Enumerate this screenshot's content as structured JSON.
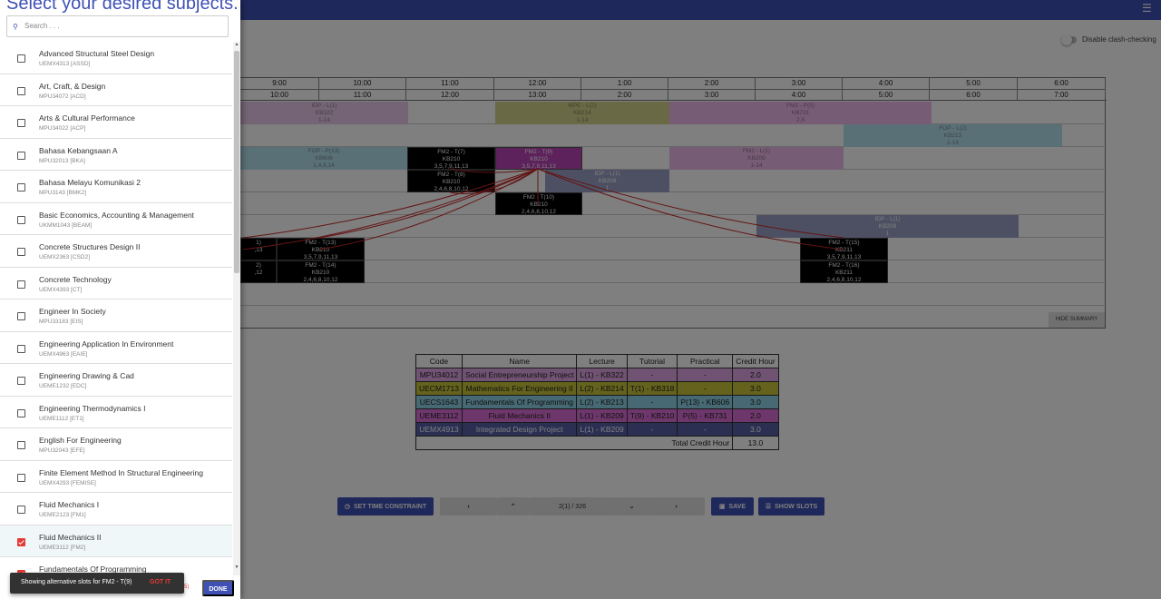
{
  "header": {
    "menu_icon": "hamburger-menu-icon"
  },
  "clash": {
    "label": "Disable clash-checking"
  },
  "timetable": {
    "columns": [
      {
        "start": "9:00",
        "end": "10:00"
      },
      {
        "start": "10:00",
        "end": "11:00"
      },
      {
        "start": "11:00",
        "end": "12:00"
      },
      {
        "start": "12:00",
        "end": "13:00"
      },
      {
        "start": "1:00",
        "end": "2:00"
      },
      {
        "start": "2:00",
        "end": "3:00"
      },
      {
        "start": "3:00",
        "end": "4:00"
      },
      {
        "start": "4:00",
        "end": "5:00"
      },
      {
        "start": "5:00",
        "end": "6:00"
      },
      {
        "start": "6:00",
        "end": "7:00"
      }
    ],
    "slots": [
      {
        "l1": "IDP - L(1)",
        "l2": "KB322",
        "l3": "1-14",
        "color": "#e9c8eb"
      },
      {
        "l1": "MPE - L(2)",
        "l2": "KB214",
        "l3": "1-14",
        "color": "#d5d38a"
      },
      {
        "l1": "FM2 - P(5)",
        "l2": "KB731",
        "l3": "2,8",
        "color": "#eeb8ea"
      },
      {
        "l1": "FOP - L(2)",
        "l2": "KB213",
        "l3": "1-14",
        "color": "#b4e0ee"
      },
      {
        "l1": "FOP - P(13)",
        "l2": "KB606",
        "l3": "1,4,8,14",
        "color": "#b4e0ee"
      },
      {
        "l1": "FM2 - T(7)",
        "l2": "KB210",
        "l3": "3,5,7,9,11,13",
        "color": "#000000"
      },
      {
        "l1": "FM2 - T(9)",
        "l2": "KB210",
        "l3": "3,5,7,9,11,13",
        "color": "#bb44b9"
      },
      {
        "l1": "FM2 - L(1)",
        "l2": "KB209",
        "l3": "1-14",
        "color": "#eeb8ea"
      },
      {
        "l1": "FM2 - T(8)",
        "l2": "KB210",
        "l3": "2,4,6,8,10,12",
        "color": "#000000"
      },
      {
        "l1": "IDP - L(1)",
        "l2": "KB209",
        "l3": "1",
        "color": "#9aa0c4"
      },
      {
        "l1": "FM2 - T(10)",
        "l2": "KB210",
        "l3": "2,4,6,8,10,12",
        "color": "#000000"
      },
      {
        "l1": "IDP - L(1)",
        "l2": "KB208",
        "l3": "1",
        "color": "#9aa0c4"
      },
      {
        "l1": "1)",
        "l2": "",
        "l3": ",13",
        "color": "#000000"
      },
      {
        "l1": "FM2 - T(13)",
        "l2": "KB210",
        "l3": "3,5,7,9,11,13",
        "color": "#000000"
      },
      {
        "l1": "FM2 - T(15)",
        "l2": "KB211",
        "l3": "3,5,7,9,11,13",
        "color": "#000000"
      },
      {
        "l1": "2)",
        "l2": "",
        "l3": ",12",
        "color": "#000000"
      },
      {
        "l1": "FM2 - T(14)",
        "l2": "KB210",
        "l3": "2,4,6,8,10,12",
        "color": "#000000"
      },
      {
        "l1": "FM2 - T(16)",
        "l2": "KB211",
        "l3": "2,4,6,8,10,12",
        "color": "#000000"
      }
    ],
    "hide_summary": "HIDE SUMMARY"
  },
  "summary": {
    "headers": [
      "Code",
      "Name",
      "Lecture",
      "Tutorial",
      "Practical",
      "Credit Hour"
    ],
    "rows": [
      {
        "code": "MPU34012",
        "name": "Social Entrepreneurship Project",
        "lecture": "L(1) - KB322",
        "tutorial": "-",
        "practical": "-",
        "credit": "2.0",
        "color": "#e1a6e4"
      },
      {
        "code": "UECM1713",
        "name": "Mathematics For Engineering II",
        "lecture": "L(2) - KB214",
        "tutorial": "T(1) - KB318",
        "practical": "-",
        "credit": "3.0",
        "color": "#c9c539"
      },
      {
        "code": "UECS1643",
        "name": "Fundamentals Of Programming",
        "lecture": "L(2) - KB213",
        "tutorial": "-",
        "practical": "P(13) - KB606",
        "credit": "3.0",
        "color": "#8fd2e6"
      },
      {
        "code": "UEME3112",
        "name": "Fluid Mechanics II",
        "lecture": "L(1) - KB209",
        "tutorial": "T(9) - KB210",
        "practical": "P(5) - KB731",
        "credit": "2.0",
        "color": "#dd6fd9"
      },
      {
        "code": "UEMX4913",
        "name": "Integrated Design Project",
        "lecture": "L(1) - KB209",
        "tutorial": "-",
        "practical": "-",
        "credit": "3.0",
        "color": "#5660a6"
      }
    ],
    "total_label": "Total Credit Hour",
    "total_value": "13.0"
  },
  "controls": {
    "set_time_constraint": "SET TIME CONSTRAINT",
    "prev_icon": "chevron-left-icon",
    "up_icon": "chevron-up-icon",
    "page": "2(1) / 326",
    "down_icon": "chevron-down-icon",
    "next_icon": "chevron-right-icon",
    "save": "SAVE",
    "show_slots": "SHOW SLOTS"
  },
  "panel": {
    "title": "Select your desired subjects.",
    "search_placeholder": "Search . . .",
    "subjects": [
      {
        "name": "Advanced Structural Steel Design",
        "code": "UEMX4313 [ASSD]",
        "checked": false
      },
      {
        "name": "Art, Craft, & Design",
        "code": "MPU34072 [ACD]",
        "checked": false
      },
      {
        "name": "Arts & Cultural Performance",
        "code": "MPU34022 [ACP]",
        "checked": false
      },
      {
        "name": "Bahasa Kebangsaan A",
        "code": "MPU32013 [BKA]",
        "checked": false
      },
      {
        "name": "Bahasa Melayu Komunikasi 2",
        "code": "MPU3143 [BMK2]",
        "checked": false
      },
      {
        "name": "Basic Economics, Accounting & Management",
        "code": "UKMM1043 [BEAM]",
        "checked": false
      },
      {
        "name": "Concrete Structures Design II",
        "code": "UEMX2363 [CSD2]",
        "checked": false
      },
      {
        "name": "Concrete Technology",
        "code": "UEMX4393 [CT]",
        "checked": false
      },
      {
        "name": "Engineer In Society",
        "code": "MPU33183 [EIS]",
        "checked": false
      },
      {
        "name": "Engineering Application In Environment",
        "code": "UEMX4963 [EAIE]",
        "checked": false
      },
      {
        "name": "Engineering Drawing & Cad",
        "code": "UEME1232 [EDC]",
        "checked": false
      },
      {
        "name": "Engineering Thermodynamics I",
        "code": "UEME1112 [ET1]",
        "checked": false
      },
      {
        "name": "English For Engineering",
        "code": "MPU32043 [EFE]",
        "checked": false
      },
      {
        "name": "Finite Element Method In Structural Engineering",
        "code": "UEMX4293 [FEMISE]",
        "checked": false
      },
      {
        "name": "Fluid Mechanics I",
        "code": "UEME2123 [FM1]",
        "checked": false
      },
      {
        "name": "Fluid Mechanics II",
        "code": "UEME3112 [FM2]",
        "checked": true
      },
      {
        "name": "Fundamentals Of Programming",
        "code": "",
        "checked": true
      }
    ],
    "footer_text": "5)",
    "done": "DONE"
  },
  "snackbar": {
    "message": "Showing alternative slots for FM2 - T(9)",
    "action": "GOT IT"
  },
  "colors": {
    "primary": "#3f51b5",
    "accent": "#e53935",
    "overlay": "rgba(0,0,0,0.5)"
  }
}
